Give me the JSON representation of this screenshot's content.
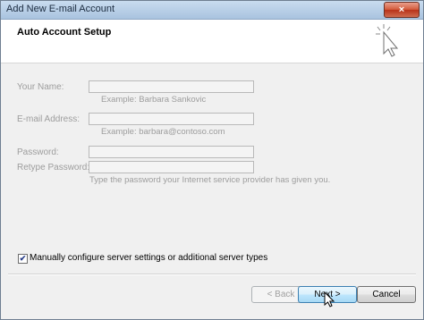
{
  "window": {
    "title": "Add New E-mail Account",
    "close_label": "×"
  },
  "header": {
    "title": "Auto Account Setup"
  },
  "form": {
    "name_label": "Your Name:",
    "name_value": "",
    "name_hint": "Example: Barbara Sankovic",
    "email_label": "E-mail Address:",
    "email_value": "",
    "email_hint": "Example: barbara@contoso.com",
    "password_label": "Password:",
    "retype_label": "Retype Password:",
    "password_hint": "Type the password your Internet service provider has given you."
  },
  "manual_config": {
    "label": "Manually configure server settings or additional server types",
    "checked": true,
    "check_glyph": "✔"
  },
  "buttons": {
    "back": "< Back",
    "next": "Next >",
    "cancel": "Cancel"
  },
  "colors": {
    "label_disabled": "#9d9d9d",
    "accent": "#3c7fb1"
  }
}
